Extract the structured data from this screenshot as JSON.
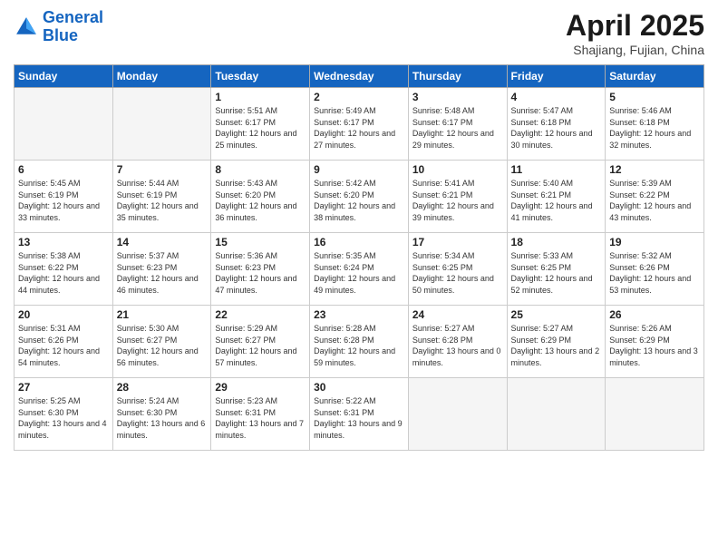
{
  "header": {
    "logo_text_general": "General",
    "logo_text_blue": "Blue",
    "title": "April 2025",
    "subtitle": "Shajiang, Fujian, China"
  },
  "calendar": {
    "days_of_week": [
      "Sunday",
      "Monday",
      "Tuesday",
      "Wednesday",
      "Thursday",
      "Friday",
      "Saturday"
    ],
    "weeks": [
      [
        {
          "day": "",
          "empty": true
        },
        {
          "day": "",
          "empty": true
        },
        {
          "day": "1",
          "sunrise": "5:51 AM",
          "sunset": "6:17 PM",
          "daylight": "12 hours and 25 minutes."
        },
        {
          "day": "2",
          "sunrise": "5:49 AM",
          "sunset": "6:17 PM",
          "daylight": "12 hours and 27 minutes."
        },
        {
          "day": "3",
          "sunrise": "5:48 AM",
          "sunset": "6:17 PM",
          "daylight": "12 hours and 29 minutes."
        },
        {
          "day": "4",
          "sunrise": "5:47 AM",
          "sunset": "6:18 PM",
          "daylight": "12 hours and 30 minutes."
        },
        {
          "day": "5",
          "sunrise": "5:46 AM",
          "sunset": "6:18 PM",
          "daylight": "12 hours and 32 minutes."
        }
      ],
      [
        {
          "day": "6",
          "sunrise": "5:45 AM",
          "sunset": "6:19 PM",
          "daylight": "12 hours and 33 minutes."
        },
        {
          "day": "7",
          "sunrise": "5:44 AM",
          "sunset": "6:19 PM",
          "daylight": "12 hours and 35 minutes."
        },
        {
          "day": "8",
          "sunrise": "5:43 AM",
          "sunset": "6:20 PM",
          "daylight": "12 hours and 36 minutes."
        },
        {
          "day": "9",
          "sunrise": "5:42 AM",
          "sunset": "6:20 PM",
          "daylight": "12 hours and 38 minutes."
        },
        {
          "day": "10",
          "sunrise": "5:41 AM",
          "sunset": "6:21 PM",
          "daylight": "12 hours and 39 minutes."
        },
        {
          "day": "11",
          "sunrise": "5:40 AM",
          "sunset": "6:21 PM",
          "daylight": "12 hours and 41 minutes."
        },
        {
          "day": "12",
          "sunrise": "5:39 AM",
          "sunset": "6:22 PM",
          "daylight": "12 hours and 43 minutes."
        }
      ],
      [
        {
          "day": "13",
          "sunrise": "5:38 AM",
          "sunset": "6:22 PM",
          "daylight": "12 hours and 44 minutes."
        },
        {
          "day": "14",
          "sunrise": "5:37 AM",
          "sunset": "6:23 PM",
          "daylight": "12 hours and 46 minutes."
        },
        {
          "day": "15",
          "sunrise": "5:36 AM",
          "sunset": "6:23 PM",
          "daylight": "12 hours and 47 minutes."
        },
        {
          "day": "16",
          "sunrise": "5:35 AM",
          "sunset": "6:24 PM",
          "daylight": "12 hours and 49 minutes."
        },
        {
          "day": "17",
          "sunrise": "5:34 AM",
          "sunset": "6:25 PM",
          "daylight": "12 hours and 50 minutes."
        },
        {
          "day": "18",
          "sunrise": "5:33 AM",
          "sunset": "6:25 PM",
          "daylight": "12 hours and 52 minutes."
        },
        {
          "day": "19",
          "sunrise": "5:32 AM",
          "sunset": "6:26 PM",
          "daylight": "12 hours and 53 minutes."
        }
      ],
      [
        {
          "day": "20",
          "sunrise": "5:31 AM",
          "sunset": "6:26 PM",
          "daylight": "12 hours and 54 minutes."
        },
        {
          "day": "21",
          "sunrise": "5:30 AM",
          "sunset": "6:27 PM",
          "daylight": "12 hours and 56 minutes."
        },
        {
          "day": "22",
          "sunrise": "5:29 AM",
          "sunset": "6:27 PM",
          "daylight": "12 hours and 57 minutes."
        },
        {
          "day": "23",
          "sunrise": "5:28 AM",
          "sunset": "6:28 PM",
          "daylight": "12 hours and 59 minutes."
        },
        {
          "day": "24",
          "sunrise": "5:27 AM",
          "sunset": "6:28 PM",
          "daylight": "13 hours and 0 minutes."
        },
        {
          "day": "25",
          "sunrise": "5:27 AM",
          "sunset": "6:29 PM",
          "daylight": "13 hours and 2 minutes."
        },
        {
          "day": "26",
          "sunrise": "5:26 AM",
          "sunset": "6:29 PM",
          "daylight": "13 hours and 3 minutes."
        }
      ],
      [
        {
          "day": "27",
          "sunrise": "5:25 AM",
          "sunset": "6:30 PM",
          "daylight": "13 hours and 4 minutes."
        },
        {
          "day": "28",
          "sunrise": "5:24 AM",
          "sunset": "6:30 PM",
          "daylight": "13 hours and 6 minutes."
        },
        {
          "day": "29",
          "sunrise": "5:23 AM",
          "sunset": "6:31 PM",
          "daylight": "13 hours and 7 minutes."
        },
        {
          "day": "30",
          "sunrise": "5:22 AM",
          "sunset": "6:31 PM",
          "daylight": "13 hours and 9 minutes."
        },
        {
          "day": "",
          "empty": true
        },
        {
          "day": "",
          "empty": true
        },
        {
          "day": "",
          "empty": true
        }
      ]
    ]
  }
}
